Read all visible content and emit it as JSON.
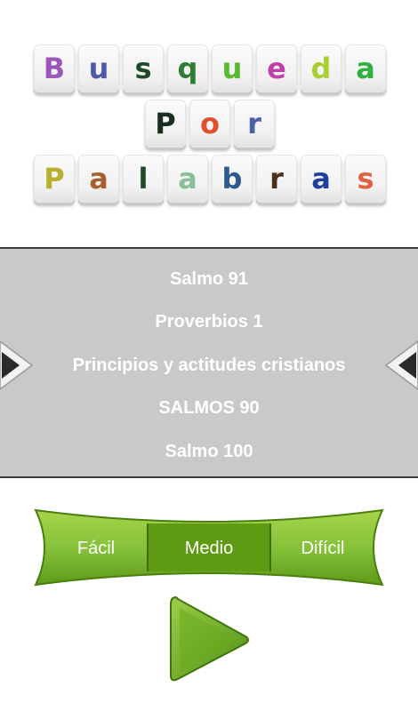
{
  "title": {
    "row1": [
      {
        "letter": "B",
        "color": "#9a58b8"
      },
      {
        "letter": "u",
        "color": "#4a5aa8"
      },
      {
        "letter": "s",
        "color": "#1e4a2a"
      },
      {
        "letter": "q",
        "color": "#2e7d32"
      },
      {
        "letter": "u",
        "color": "#58b830"
      },
      {
        "letter": "e",
        "color": "#c040a8"
      },
      {
        "letter": "d",
        "color": "#a8d030"
      },
      {
        "letter": "a",
        "color": "#30b040"
      }
    ],
    "row2": [
      {
        "letter": "P",
        "color": "#1a2e1e"
      },
      {
        "letter": "o",
        "color": "#e0502a"
      },
      {
        "letter": "r",
        "color": "#4860a8"
      }
    ],
    "row3": [
      {
        "letter": "P",
        "color": "#b8b030"
      },
      {
        "letter": "a",
        "color": "#a86030"
      },
      {
        "letter": "l",
        "color": "#1e4a2a"
      },
      {
        "letter": "a",
        "color": "#88c098"
      },
      {
        "letter": "b",
        "color": "#2e5a8a"
      },
      {
        "letter": "r",
        "color": "#4a3018"
      },
      {
        "letter": "a",
        "color": "#2040a0"
      },
      {
        "letter": "s",
        "color": "#e06040"
      }
    ]
  },
  "carousel": {
    "items": [
      "Salmo 91",
      "Proverbios 1",
      "Principios y actitudes cristianos",
      "SALMOS 90",
      "Salmo 100"
    ],
    "selected_index": 2
  },
  "difficulty": {
    "options": [
      "Fácil",
      "Medio",
      "Difícil"
    ],
    "selected": "Medio"
  },
  "colors": {
    "green_light": "#8cc63f",
    "green_dark": "#4a8a10",
    "green_selected": "#5e9a12",
    "carousel_bg": "#c9c9c9"
  },
  "icons": {
    "left_arrow": "triangle-left",
    "right_arrow": "triangle-right",
    "play": "triangle-play"
  }
}
